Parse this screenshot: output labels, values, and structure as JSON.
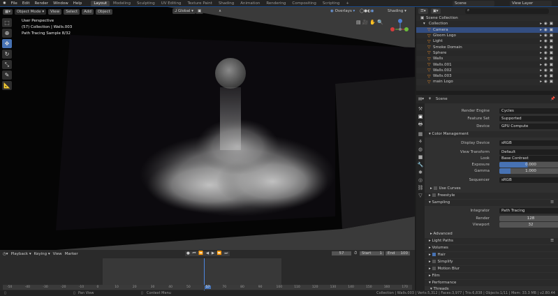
{
  "topbar": {
    "menus": [
      "File",
      "Edit",
      "Render",
      "Window",
      "Help"
    ],
    "workspaces": [
      "Layout",
      "Modeling",
      "Sculpting",
      "UV Editing",
      "Texture Paint",
      "Shading",
      "Animation",
      "Rendering",
      "Compositing",
      "Scripting"
    ],
    "active_workspace": "Layout",
    "scene": "Scene",
    "view_layer": "View Layer"
  },
  "viewport": {
    "mode": "Object Mode",
    "menus": [
      "View",
      "Select",
      "Add",
      "Object"
    ],
    "orientation": "Global",
    "overlays": "Overlays",
    "shading": "Shading",
    "info": [
      "User Perspective",
      "(57) Collection | Walls.003",
      "Path Tracing Sample 8/32"
    ]
  },
  "outliner": {
    "search_placeholder": "",
    "root": "Scene Collection",
    "collection": "Collection",
    "items": [
      {
        "name": "Camera",
        "selected": true
      },
      {
        "name": "Gloom Logo"
      },
      {
        "name": "Light"
      },
      {
        "name": "Smoke Domain"
      },
      {
        "name": "Sphere"
      },
      {
        "name": "Walls"
      },
      {
        "name": "Walls.001"
      },
      {
        "name": "Walls.002"
      },
      {
        "name": "Walls.003"
      },
      {
        "name": "main Logo"
      }
    ]
  },
  "properties": {
    "context": "Scene",
    "render_engine": {
      "label": "Render Engine",
      "value": "Cycles"
    },
    "feature_set": {
      "label": "Feature Set",
      "value": "Supported"
    },
    "device": {
      "label": "Device",
      "value": "GPU Compute"
    },
    "color_management": "Color Management",
    "display_device": {
      "label": "Display Device",
      "value": "sRGB"
    },
    "view_transform": {
      "label": "View Transform",
      "value": "Default"
    },
    "look": {
      "label": "Look",
      "value": "Base Contrast"
    },
    "exposure": {
      "label": "Exposure",
      "value": "0.000",
      "fill": 0.45
    },
    "gamma": {
      "label": "Gamma",
      "value": "1.000",
      "fill": 0.18
    },
    "sequencer": {
      "label": "Sequencer",
      "value": "sRGB"
    },
    "use_curves": "Use Curves",
    "freestyle": "Freestyle",
    "sampling": "Sampling",
    "integrator": {
      "label": "Integrator",
      "value": "Path Tracing"
    },
    "render": {
      "label": "Render",
      "value": "128"
    },
    "viewport_samples": {
      "label": "Viewport",
      "value": "32"
    },
    "advanced": "Advanced",
    "light_paths": "Light Paths",
    "volumes": "Volumes",
    "hair": "Hair",
    "simplify": "Simplify",
    "motion_blur": "Motion Blur",
    "film": "Film",
    "performance": "Performance",
    "threads": "Threads"
  },
  "timeline": {
    "menus": [
      "Playback",
      "Keying",
      "View",
      "Marker"
    ],
    "current_frame": "57",
    "start_label": "Start",
    "start": "1",
    "end_label": "End",
    "end": "100",
    "ticks": [
      "-50",
      "-40",
      "-30",
      "-20",
      "-10",
      "0",
      "10",
      "20",
      "30",
      "40",
      "50",
      "57",
      "70",
      "80",
      "90",
      "100",
      "110",
      "120",
      "130",
      "140",
      "150",
      "160",
      "170"
    ]
  },
  "statusbar": {
    "pan": "Pan View",
    "context": "Context Menu",
    "stats": "Collection | Walls.003 | Verts:5,312 | Faces:3,977 | Tris:6,838 | Objects:1/11 | Mem: 33.3 MB | v2.80.44"
  }
}
